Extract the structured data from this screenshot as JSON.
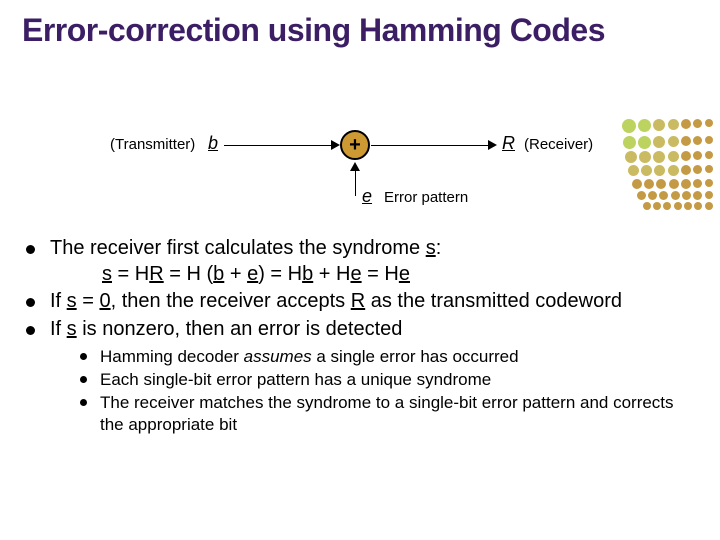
{
  "title": "Error-correction using Hamming Codes",
  "diagram": {
    "tx": "(Transmitter)",
    "b": "b",
    "plus": "+",
    "R": "R",
    "rx": "(Receiver)",
    "e": "e",
    "err": "Error pattern"
  },
  "bullets": {
    "b1_pre": "The receiver first calculates the syndrome ",
    "b1_s": "s",
    "b1_post": ":",
    "eq_s1": "s",
    "eq_eq1": " = H",
    "eq_R": "R",
    "eq_eq2": " = H (",
    "eq_b": "b",
    "eq_plus": " + ",
    "eq_e": "e",
    "eq_close": ") = H",
    "eq_b2": "b",
    "eq_plus2": " + H",
    "eq_e2": "e",
    "eq_eq3": " = H",
    "eq_e3": "e",
    "b2_pre": "If ",
    "b2_s": "s",
    "b2_mid": " = ",
    "b2_zero": "0",
    "b2_mid2": ", then the receiver accepts ",
    "b2_R": "R",
    "b2_post": " as the transmitted codeword",
    "b3_pre": "If ",
    "b3_s": "s",
    "b3_post": " is nonzero, then an error is detected",
    "sub1_a": "Hamming decoder ",
    "sub1_b": "assumes",
    "sub1_c": " a single error has occurred",
    "sub2": "Each single-bit error pattern has a unique syndrome",
    "sub3": "The receiver matches the syndrome to a single-bit error pattern and corrects the appropriate bit"
  },
  "deco": {
    "colors": [
      "#bcd35f",
      "#bcd35f",
      "#cabb63",
      "#cabb63",
      "#c59a45",
      "#c59a45",
      "#c59a45"
    ],
    "sizes": [
      14,
      13,
      12,
      11,
      10,
      9,
      8
    ]
  }
}
